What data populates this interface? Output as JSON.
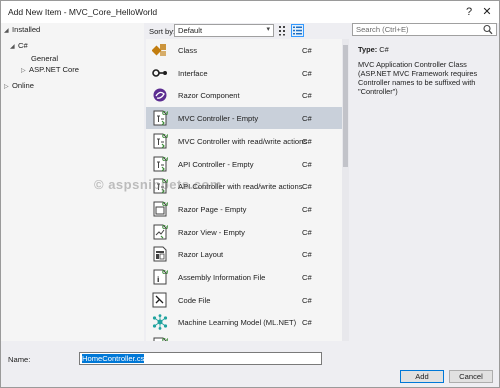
{
  "window": {
    "title": "Add New Item - MVC_Core_HelloWorld",
    "help_label": "?",
    "close_label": "✕"
  },
  "tree": {
    "installed": "Installed",
    "csharp": "C#",
    "general": "General",
    "aspnet": "ASP.NET Core",
    "online": "Online"
  },
  "toolbar": {
    "sort_label": "Sort by:",
    "sort_value": "Default"
  },
  "search": {
    "placeholder": "Search (Ctrl+E)",
    "icon": "search-icon"
  },
  "templates": [
    {
      "name": "Class",
      "lang": "C#",
      "icon": "class-icon"
    },
    {
      "name": "Interface",
      "lang": "C#",
      "icon": "interface-icon"
    },
    {
      "name": "Razor Component",
      "lang": "C#",
      "icon": "razor-component-icon"
    },
    {
      "name": "MVC Controller - Empty",
      "lang": "C#",
      "icon": "controller-icon"
    },
    {
      "name": "MVC Controller with read/write actions",
      "lang": "C#",
      "icon": "controller-icon"
    },
    {
      "name": "API Controller - Empty",
      "lang": "C#",
      "icon": "controller-icon"
    },
    {
      "name": "API Controller with read/write actions",
      "lang": "C#",
      "icon": "controller-icon"
    },
    {
      "name": "Razor Page - Empty",
      "lang": "C#",
      "icon": "razor-page-icon"
    },
    {
      "name": "Razor View - Empty",
      "lang": "C#",
      "icon": "razor-view-icon"
    },
    {
      "name": "Razor Layout",
      "lang": "C#",
      "icon": "razor-layout-icon"
    },
    {
      "name": "Assembly Information File",
      "lang": "C#",
      "icon": "assembly-info-icon"
    },
    {
      "name": "Code File",
      "lang": "C#",
      "icon": "code-file-icon"
    },
    {
      "name": "Machine Learning Model (ML.NET)",
      "lang": "C#",
      "icon": "ml-model-icon"
    },
    {
      "name": "",
      "lang": "C#",
      "icon": "controller-icon"
    }
  ],
  "selected_template": "MVC Controller - Empty",
  "description": {
    "type_label": "Type:",
    "type_value": "C#",
    "text": "MVC Application Controller Class (ASP.NET MVC Framework requires Controller names to be suffixed with \"Controller\")"
  },
  "watermark": "© aspsnippets.com",
  "bottom": {
    "name_label": "Name:",
    "name_value": "HomeController.cs",
    "add_label": "Add",
    "cancel_label": "Cancel"
  },
  "colors": {
    "accent": "#0078d7",
    "selection": "#c9d0da",
    "csharp_green": "#388a34",
    "razor_purple": "#5c2d91"
  }
}
